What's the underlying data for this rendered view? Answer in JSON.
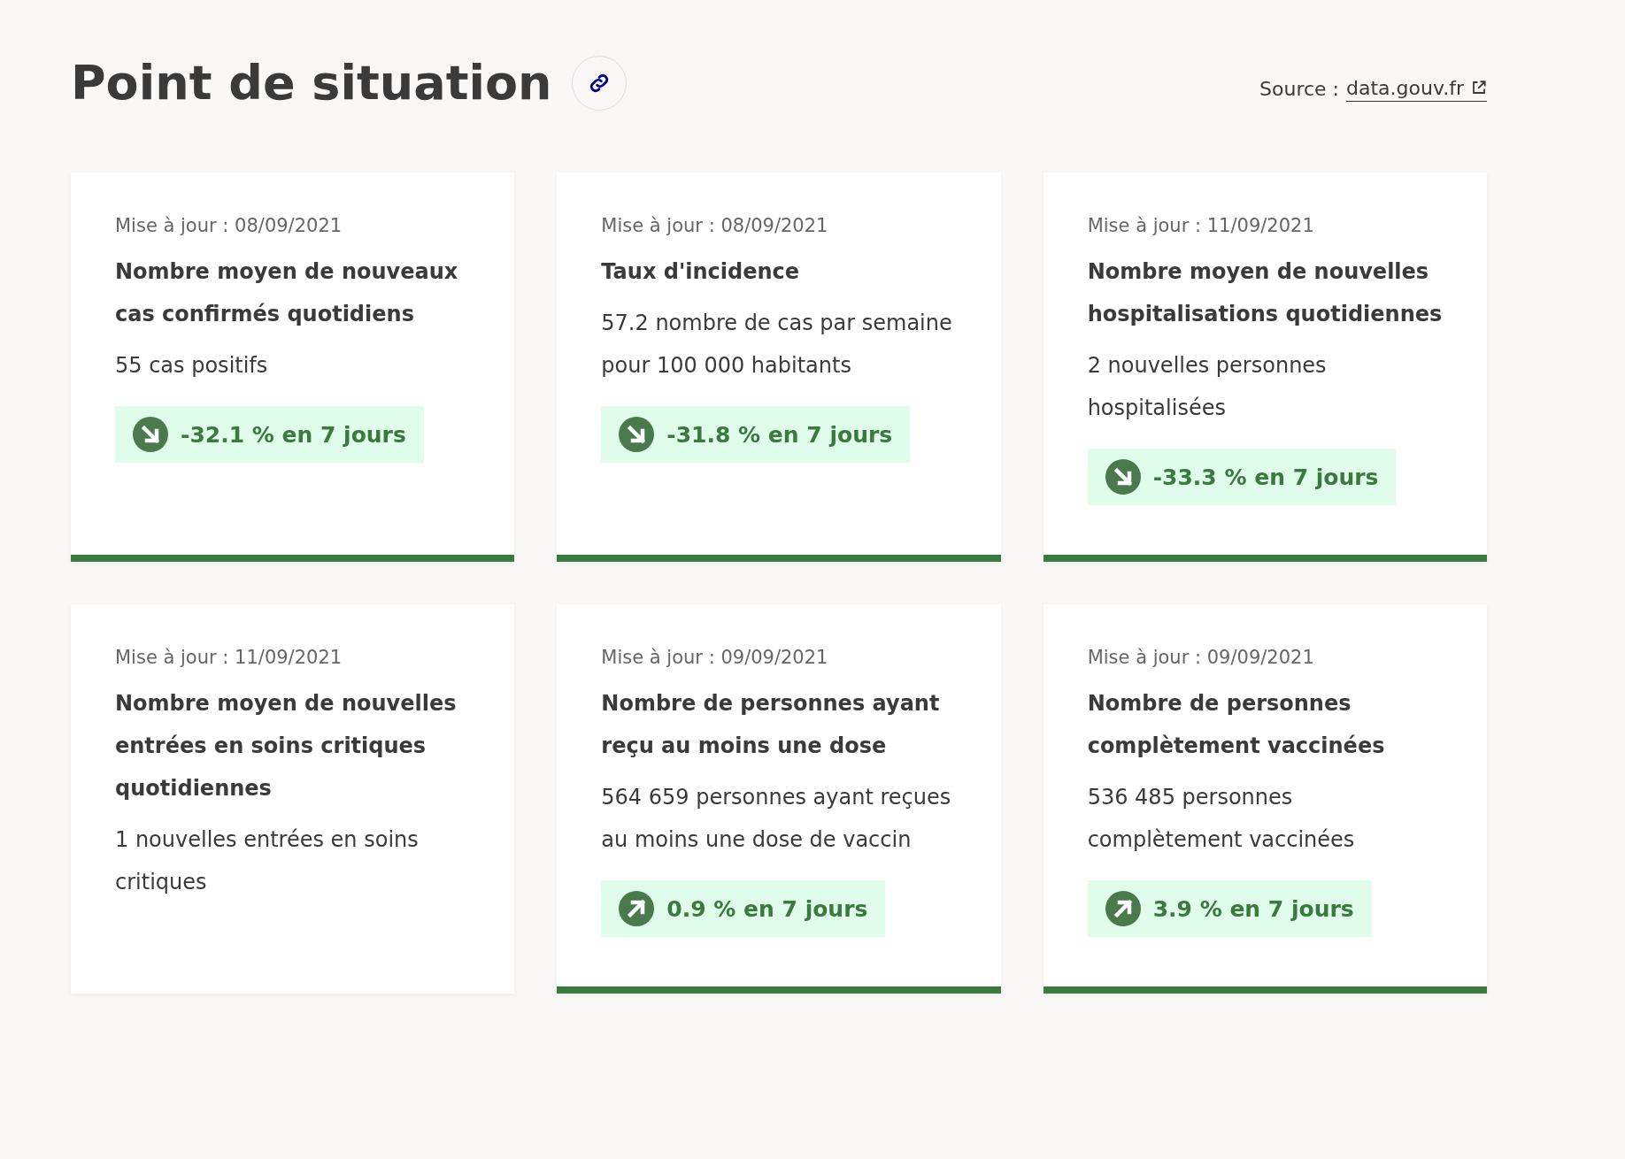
{
  "header": {
    "title": "Point de situation",
    "source_label": "Source :",
    "source_link": "data.gouv.fr"
  },
  "cards": [
    {
      "updated": "Mise à jour : 08/09/2021",
      "title": "Nombre moyen de nouveaux cas confirmés quotidiens",
      "value": "55 cas positifs",
      "trend": {
        "kind": "down",
        "label": "-32.1 % en 7 jours"
      }
    },
    {
      "updated": "Mise à jour : 08/09/2021",
      "title": "Taux d'incidence",
      "value": "57.2 nombre de cas par semaine pour 100 000 habitants",
      "trend": {
        "kind": "down",
        "label": "-31.8 % en 7 jours"
      }
    },
    {
      "updated": "Mise à jour : 11/09/2021",
      "title": "Nombre moyen de nouvelles hospitalisations quotidiennes",
      "value": "2 nouvelles personnes hospitalisées",
      "trend": {
        "kind": "down",
        "label": "-33.3 % en 7 jours"
      }
    },
    {
      "updated": "Mise à jour : 11/09/2021",
      "title": "Nombre moyen de nouvelles entrées en soins critiques quotidiennes",
      "value": "1 nouvelles entrées en soins critiques"
    },
    {
      "updated": "Mise à jour : 09/09/2021",
      "title": "Nombre de personnes ayant reçu au moins une dose",
      "value": "564 659 personnes ayant reçues au moins une dose de vaccin",
      "trend": {
        "kind": "up",
        "label": "0.9 % en 7 jours"
      }
    },
    {
      "updated": "Mise à jour : 09/09/2021",
      "title": "Nombre de personnes complètement vaccinées",
      "value": "536 485 personnes complètement vaccinées",
      "trend": {
        "kind": "up",
        "label": "3.9 % en 7 jours"
      }
    }
  ]
}
